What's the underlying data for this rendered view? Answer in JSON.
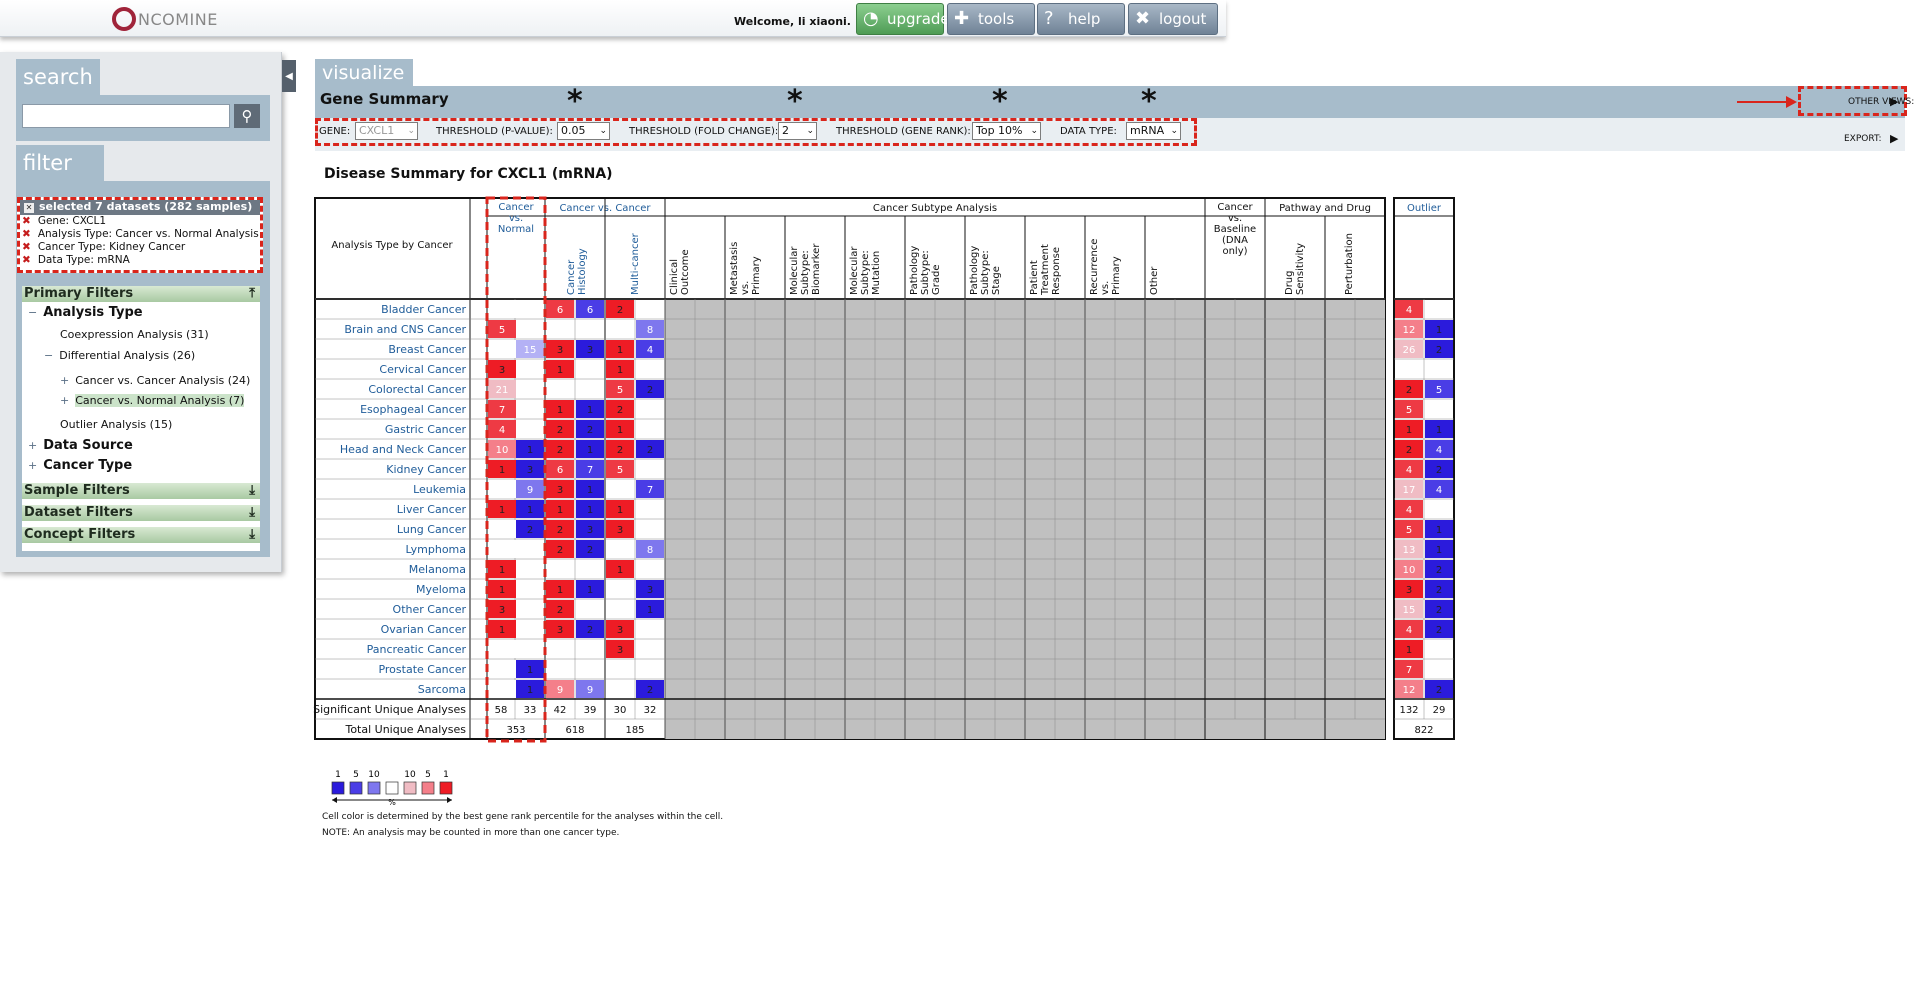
{
  "header": {
    "logo_text": "NCOMINE",
    "welcome": "Welcome, li xiaoni.",
    "buttons": {
      "upgrade": "upgrade",
      "tools": "tools",
      "help": "help",
      "logout": "logout"
    }
  },
  "sidebar": {
    "search_tab": "search",
    "filter_tab": "filter",
    "selected_header": "selected 7 datasets (282 samples)",
    "selected_items": [
      "Gene: CXCL1",
      "Analysis Type: Cancer vs. Normal Analysis",
      "Cancer Type: Kidney Cancer",
      "Data Type: mRNA"
    ],
    "primary_filters": "Primary Filters",
    "tree": {
      "analysis_type": "Analysis Type",
      "coexpression": "Coexpression Analysis (31)",
      "differential": "Differential Analysis (26)",
      "cvc": "Cancer vs. Cancer Analysis (24)",
      "cvn": "Cancer vs. Normal Analysis (7)",
      "outlier": "Outlier Analysis (15)",
      "data_source": "Data Source",
      "cancer_type": "Cancer Type"
    },
    "sample_filters": "Sample Filters",
    "dataset_filters": "Dataset Filters",
    "concept_filters": "Concept Filters"
  },
  "main": {
    "tab": "visualize",
    "title": "Gene Summary",
    "controls": {
      "gene_label": "GENE:",
      "gene_value": "CXCL1",
      "pval_label": "THRESHOLD (P-VALUE):",
      "pval_value": "0.05",
      "fold_label": "THRESHOLD (FOLD CHANGE):",
      "fold_value": "2",
      "rank_label": "THRESHOLD (GENE RANK):",
      "rank_value": "Top 10%",
      "dtype_label": "DATA TYPE:",
      "dtype_value": "mRNA"
    },
    "other_views": "OTHER VIEWS:",
    "export": "EXPORT:",
    "disease_title": "Disease Summary for CXCL1 (mRNA)",
    "legend": {
      "top_labels": [
        "1",
        "5",
        "10",
        "10",
        "5",
        "1"
      ],
      "pct": "%",
      "note1": "Cell color is determined by the best gene rank percentile for the analyses within the cell.",
      "note2": "NOTE: An analysis may be counted in more than one cancer type."
    }
  },
  "chart_data": {
    "type": "heatmap",
    "row_header": "Analysis Type by Cancer",
    "groups": [
      {
        "name": "Cancer vs. Normal",
        "columns": []
      },
      {
        "name": "Cancer vs. Cancer",
        "columns": [
          "Cancer Histology",
          "Multi-cancer"
        ]
      },
      {
        "name": "Cancer Subtype Analysis",
        "columns": [
          "Clinical Outcome",
          "Metastasis vs. Primary",
          "Molecular Subtype: Biomarker",
          "Molecular Subtype: Mutation",
          "Pathology Subtype: Grade",
          "Pathology Subtype: Stage",
          "Patient Treatment Response",
          "Recurrence vs. Primary",
          "Other"
        ]
      },
      {
        "name": "Cancer vs. Baseline (DNA only)",
        "columns": []
      },
      {
        "name": "Pathway and Drug",
        "columns": [
          "Drug Sensitivity",
          "Perturbation"
        ]
      },
      {
        "name": "Outlier",
        "columns": []
      }
    ],
    "rows": [
      {
        "name": "Bladder Cancer",
        "cvn": [
          null,
          null
        ],
        "hist": [
          6,
          6
        ],
        "multi": [
          2,
          null
        ],
        "out": [
          4,
          null
        ]
      },
      {
        "name": "Brain and CNS Cancer",
        "cvn": [
          5,
          null
        ],
        "hist": [
          null,
          null
        ],
        "multi": [
          null,
          8
        ],
        "out": [
          12,
          1
        ]
      },
      {
        "name": "Breast Cancer",
        "cvn": [
          null,
          15
        ],
        "hist": [
          3,
          3
        ],
        "multi": [
          1,
          4
        ],
        "out": [
          26,
          2
        ]
      },
      {
        "name": "Cervical Cancer",
        "cvn": [
          3,
          null
        ],
        "hist": [
          1,
          null
        ],
        "multi": [
          1,
          null
        ],
        "out": [
          null,
          null
        ]
      },
      {
        "name": "Colorectal Cancer",
        "cvn": [
          21,
          null
        ],
        "hist": [
          null,
          null
        ],
        "multi": [
          5,
          2
        ],
        "out": [
          2,
          5
        ]
      },
      {
        "name": "Esophageal Cancer",
        "cvn": [
          7,
          null
        ],
        "hist": [
          1,
          1
        ],
        "multi": [
          2,
          null
        ],
        "out": [
          5,
          null
        ]
      },
      {
        "name": "Gastric Cancer",
        "cvn": [
          4,
          null
        ],
        "hist": [
          2,
          2
        ],
        "multi": [
          1,
          null
        ],
        "out": [
          1,
          1
        ]
      },
      {
        "name": "Head and Neck Cancer",
        "cvn": [
          10,
          1
        ],
        "hist": [
          2,
          1
        ],
        "multi": [
          2,
          2
        ],
        "out": [
          2,
          4
        ]
      },
      {
        "name": "Kidney Cancer",
        "cvn": [
          1,
          3
        ],
        "hist": [
          6,
          7
        ],
        "multi": [
          5,
          null
        ],
        "out": [
          4,
          2
        ]
      },
      {
        "name": "Leukemia",
        "cvn": [
          null,
          9
        ],
        "hist": [
          3,
          1
        ],
        "multi": [
          null,
          7
        ],
        "out": [
          17,
          4
        ]
      },
      {
        "name": "Liver Cancer",
        "cvn": [
          1,
          1
        ],
        "hist": [
          1,
          1
        ],
        "multi": [
          1,
          null
        ],
        "out": [
          4,
          null
        ]
      },
      {
        "name": "Lung Cancer",
        "cvn": [
          null,
          2
        ],
        "hist": [
          2,
          3
        ],
        "multi": [
          3,
          null
        ],
        "out": [
          5,
          1
        ]
      },
      {
        "name": "Lymphoma",
        "cvn": [
          null,
          null
        ],
        "hist": [
          2,
          2
        ],
        "multi": [
          null,
          8
        ],
        "out": [
          13,
          1
        ]
      },
      {
        "name": "Melanoma",
        "cvn": [
          1,
          null
        ],
        "hist": [
          null,
          null
        ],
        "multi": [
          1,
          null
        ],
        "out": [
          10,
          2
        ]
      },
      {
        "name": "Myeloma",
        "cvn": [
          1,
          null
        ],
        "hist": [
          1,
          1
        ],
        "multi": [
          null,
          3
        ],
        "out": [
          3,
          2
        ]
      },
      {
        "name": "Other Cancer",
        "cvn": [
          3,
          null
        ],
        "hist": [
          2,
          null
        ],
        "multi": [
          null,
          1
        ],
        "out": [
          15,
          2
        ]
      },
      {
        "name": "Ovarian Cancer",
        "cvn": [
          1,
          null
        ],
        "hist": [
          3,
          2
        ],
        "multi": [
          3,
          null
        ],
        "out": [
          4,
          2
        ]
      },
      {
        "name": "Pancreatic Cancer",
        "cvn": [
          null,
          null
        ],
        "hist": [
          null,
          null
        ],
        "multi": [
          3,
          null
        ],
        "out": [
          1,
          null
        ]
      },
      {
        "name": "Prostate Cancer",
        "cvn": [
          null,
          1
        ],
        "hist": [
          null,
          null
        ],
        "multi": [
          null,
          null
        ],
        "out": [
          7,
          null
        ]
      },
      {
        "name": "Sarcoma",
        "cvn": [
          null,
          1
        ],
        "hist": [
          9,
          9
        ],
        "multi": [
          null,
          2
        ],
        "out": [
          12,
          2
        ]
      }
    ],
    "summary_rows": [
      {
        "name": "Significant Unique Analyses",
        "cvn": [
          58,
          33
        ],
        "hist": [
          42,
          39
        ],
        "multi": [
          30,
          32
        ],
        "out": [
          132,
          29
        ]
      },
      {
        "name": "Total Unique Analyses",
        "cvn": [
          353
        ],
        "cvc": [
          618,
          185
        ],
        "out": [
          822
        ]
      }
    ],
    "color_rank": {
      "Bladder Cancer": [
        "",
        "",
        "r1",
        "b2",
        "r3",
        "",
        "r1",
        ""
      ],
      "_": "intensity keys"
    }
  },
  "colors": {
    "tab": "#a7bccb",
    "dash": "#d9251c",
    "link": "#1f5c99",
    "grid": "#c0c0c0",
    "red_strong": "#ee1c25",
    "blue_strong": "#2b1bdc"
  }
}
